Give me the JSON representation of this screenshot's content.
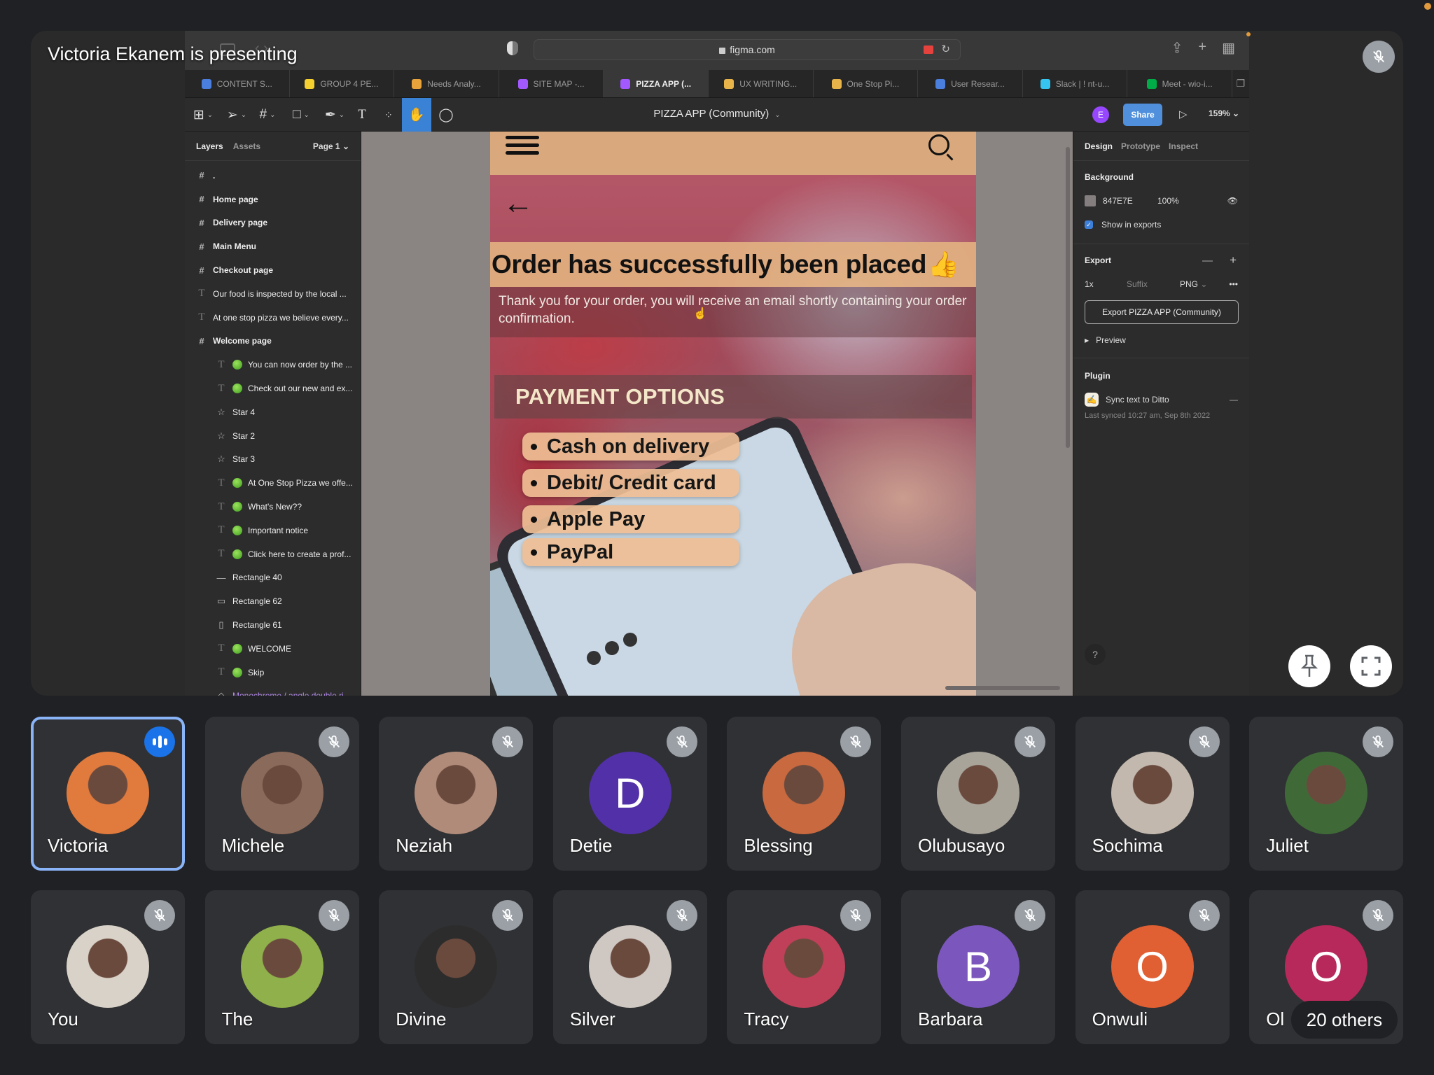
{
  "meet": {
    "presenter_label": "Victoria Ekanem is presenting",
    "others_label": "20 others",
    "participants_row1": [
      {
        "name": "Victoria",
        "initial": "",
        "avatar_color": "#e07a3d",
        "state": "speaking",
        "pinned_frame": true
      },
      {
        "name": "Michele",
        "initial": "",
        "avatar_color": "#8a6a5a",
        "state": "muted"
      },
      {
        "name": "Neziah",
        "initial": "",
        "avatar_color": "#b08b7a",
        "state": "muted"
      },
      {
        "name": "Detie",
        "initial": "D",
        "avatar_color": "#5230a8",
        "state": "muted"
      },
      {
        "name": "Blessing",
        "initial": "",
        "avatar_color": "#c8693f",
        "state": "muted"
      },
      {
        "name": "Olubusayo",
        "initial": "",
        "avatar_color": "#a9a49a",
        "state": "muted"
      },
      {
        "name": "Sochima",
        "initial": "",
        "avatar_color": "#c2b8ae",
        "state": "muted"
      },
      {
        "name": "Juliet",
        "initial": "",
        "avatar_color": "#3f6a38",
        "state": "muted"
      }
    ],
    "participants_row2": [
      {
        "name": "You",
        "initial": "",
        "avatar_color": "#d9d2c8",
        "state": "muted"
      },
      {
        "name": "The",
        "initial": "",
        "avatar_color": "#8fb04a",
        "state": "muted"
      },
      {
        "name": "Divine",
        "initial": "",
        "avatar_color": "#2c2c2c",
        "state": "muted"
      },
      {
        "name": "Silver",
        "initial": "",
        "avatar_color": "#cfc8c2",
        "state": "muted"
      },
      {
        "name": "Tracy",
        "initial": "",
        "avatar_color": "#c0405a",
        "state": "muted"
      },
      {
        "name": "Barbara",
        "initial": "B",
        "avatar_color": "#7b57bd",
        "state": "muted"
      },
      {
        "name": "Onwuli",
        "initial": "O",
        "avatar_color": "#e05f33",
        "state": "muted"
      },
      {
        "name": "Ol",
        "initial": "O",
        "avatar_color": "#b7295a",
        "state": "muted"
      }
    ]
  },
  "browser": {
    "url": "figma.com",
    "tabs": [
      {
        "label": "CONTENT S...",
        "icon": "google-docs-icon",
        "color": "#4a7fe0"
      },
      {
        "label": "GROUP 4 PE...",
        "icon": "miro-icon",
        "color": "#f5d02f"
      },
      {
        "label": "Needs Analy...",
        "icon": "airtable-icon",
        "color": "#e8a33a"
      },
      {
        "label": "SITE MAP -...",
        "icon": "figma-icon",
        "color": "#a259ff"
      },
      {
        "label": "PIZZA APP (...",
        "icon": "figma-icon",
        "color": "#a259ff",
        "active": true
      },
      {
        "label": "UX WRITING...",
        "icon": "google-slides-icon",
        "color": "#e8b44a"
      },
      {
        "label": "One Stop Pi...",
        "icon": "google-slides-icon",
        "color": "#e8b44a"
      },
      {
        "label": "User Resear...",
        "icon": "google-docs-icon",
        "color": "#4a7fe0"
      },
      {
        "label": "Slack | ! nt-u...",
        "icon": "slack-icon",
        "color": "#36c5f0"
      },
      {
        "label": "Meet - wio-i...",
        "icon": "google-meet-icon",
        "color": "#00ac47"
      }
    ]
  },
  "figma": {
    "file_title": "PIZZA APP (Community)",
    "user_initial": "E",
    "share_label": "Share",
    "zoom": "159%",
    "layers_tab": "Layers",
    "assets_tab": "Assets",
    "page": "Page 1",
    "layers": [
      {
        "label": ".",
        "type": "frame"
      },
      {
        "label": "Home page",
        "type": "frame"
      },
      {
        "label": "Delivery page",
        "type": "frame"
      },
      {
        "label": "Main Menu",
        "type": "frame"
      },
      {
        "label": "Checkout page",
        "type": "frame"
      },
      {
        "label": "Our food is inspected by the local ...",
        "type": "text"
      },
      {
        "label": "At one stop pizza we believe every...",
        "type": "text"
      },
      {
        "label": "Welcome page",
        "type": "frame"
      },
      {
        "label": "You can now order by the ...",
        "type": "text-child",
        "dot": true
      },
      {
        "label": "Check out our new and ex...",
        "type": "text-child",
        "dot": true
      },
      {
        "label": "Star 4",
        "type": "star"
      },
      {
        "label": "Star 2",
        "type": "star"
      },
      {
        "label": "Star 3",
        "type": "star"
      },
      {
        "label": "At One Stop Pizza we offe...",
        "type": "text-child",
        "dot": true
      },
      {
        "label": "What's New??",
        "type": "text-child",
        "dot": true
      },
      {
        "label": "Important notice",
        "type": "text-child",
        "dot": true
      },
      {
        "label": "Click here to create a prof...",
        "type": "text-child",
        "dot": true
      },
      {
        "label": "Rectangle 40",
        "type": "line"
      },
      {
        "label": "Rectangle 62",
        "type": "rect-h"
      },
      {
        "label": "Rectangle 61",
        "type": "rect-v"
      },
      {
        "label": "WELCOME",
        "type": "text-child",
        "dot": true
      },
      {
        "label": "Skip",
        "type": "text-child",
        "dot": true
      },
      {
        "label": "Monochrome / angle double ri...",
        "type": "component"
      }
    ],
    "design_panel": {
      "tabs": [
        "Design",
        "Prototype",
        "Inspect"
      ],
      "background_label": "Background",
      "bg_hex": "847E7E",
      "bg_opacity": "100%",
      "show_in_exports": "Show in exports",
      "export_label": "Export",
      "export_scale": "1x",
      "suffix_placeholder": "Suffix",
      "format": "PNG",
      "export_button": "Export PIZZA APP (Community)",
      "preview_label": "Preview",
      "plugin_label": "Plugin",
      "plugin_name": "Sync text to Ditto",
      "last_synced": "Last synced 10:27 am, Sep 8th 2022"
    },
    "artboard": {
      "title": "Order has successfully been placed",
      "emoji": "👍",
      "message": "Thank you for your order, you will receive an email shortly containing your order confirmation.",
      "payment_heading": "PAYMENT OPTIONS",
      "payment_options": [
        "Cash on delivery",
        "Debit/ Credit card",
        "Apple Pay",
        "PayPal"
      ]
    }
  }
}
